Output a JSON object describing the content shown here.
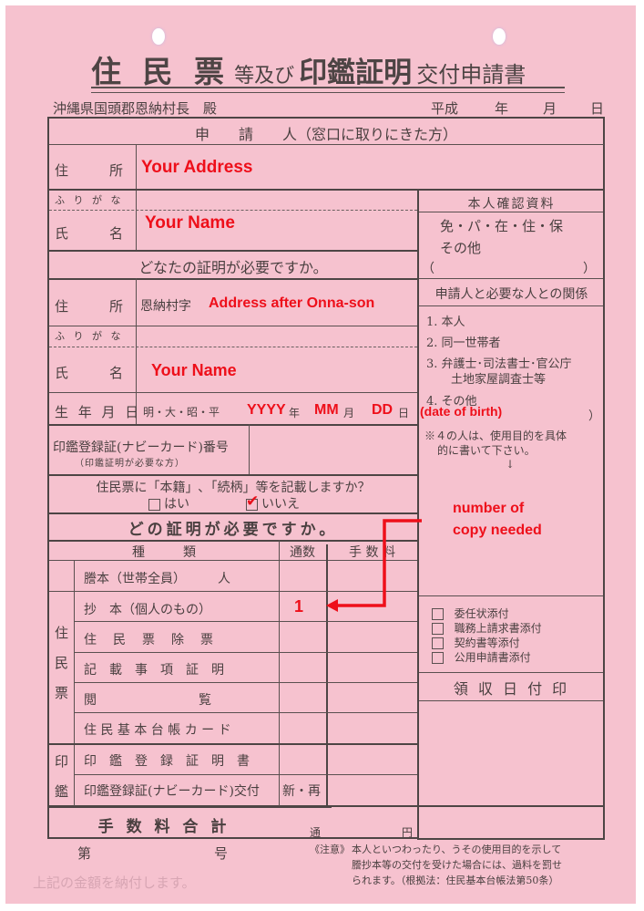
{
  "document": {
    "title_parts": [
      "住 民 票",
      "等及び",
      "印鑑証明",
      "交付申請書"
    ],
    "addressee": "沖縄県国頭郡恩納村長　殿",
    "date_label": {
      "era": "平成",
      "year": "年",
      "month": "月",
      "day": "日"
    }
  },
  "applicant": {
    "header": "申　　請　　人（窓口に取りにきた方）",
    "address_label": "住　　　所",
    "address_value": "Your Address",
    "furigana_label": "ふ り が な",
    "name_label": "氏　　　名",
    "name_value": "Your Name"
  },
  "id_docs": {
    "header": "本人確認資料",
    "options": "免・パ・在・住・保",
    "other": "その他",
    "paren_open": "（",
    "paren_close": "）"
  },
  "target_person": {
    "header": "どなたの証明が必要ですか。",
    "address_label": "住　　　所",
    "address_prefix": "恩納村字",
    "address_value": "Address after Onna-son",
    "furigana_label": "ふ り が な",
    "name_label": "氏　　　名",
    "name_value": "Your Name",
    "dob_label": "生 年 月 日",
    "era_options": "明・大・昭・平",
    "dob_year": "YYYY",
    "dob_year_unit": "年",
    "dob_month": "MM",
    "dob_month_unit": "月",
    "dob_day": "DD",
    "dob_day_unit": "日",
    "dob_annotation": "(date of birth)"
  },
  "relationship": {
    "header": "申請人と必要な人との関係",
    "items": [
      {
        "num": "1.",
        "text": "本人"
      },
      {
        "num": "2.",
        "text": "同一世帯者"
      },
      {
        "num": "3.",
        "text": "弁護士･司法書士･官公庁",
        "text2": "土地家屋調査士等"
      },
      {
        "num": "4.",
        "text": "その他"
      }
    ],
    "paren_close": "）",
    "note_line1": "※４の人は、使用目的を具体",
    "note_line2": "的に書いて下さい。",
    "arrow": "↓"
  },
  "seal_card": {
    "label": "印鑑登録証(ナビーカード)番号",
    "sub_label": "（印鑑証明が必要な方）",
    "value": ""
  },
  "honseki_question": {
    "text": "住民票に「本籍」､「続柄」等を記載しますか？",
    "yes_label": "はい",
    "no_label": "いいえ",
    "yes_checked": false,
    "no_checked": true,
    "check_mark": "✔"
  },
  "which_cert": {
    "header": "どの証明が必要ですか。",
    "col_type": "種　　　類",
    "col_copies": "通数",
    "col_fee": "手 数 料",
    "group_juminhyo": [
      "住",
      "民",
      "票"
    ],
    "group_inkan": [
      "印",
      "鑑"
    ],
    "rows": [
      {
        "label": "謄本（世帯全員）　　　人",
        "copies": ""
      },
      {
        "label": "抄　本（個人のもの）",
        "copies": "1"
      },
      {
        "label": "住　民　票　除　票",
        "copies": ""
      },
      {
        "label": "記　載　事　項　証　明",
        "copies": ""
      },
      {
        "label": "閲　　　　　　　　覧",
        "copies": ""
      },
      {
        "label": "住 民 基 本 台 帳 カ ー ド",
        "copies": ""
      },
      {
        "label": "印　鑑　登　録　証　明　書",
        "copies": ""
      },
      {
        "label": "印鑑登録証(ナビーカード)交付",
        "copies": "新・再"
      }
    ],
    "total_label": "手 数 料 合 計",
    "total_copies_unit": "通",
    "total_fee_unit": "円"
  },
  "attachments": [
    {
      "label": "委任状添付",
      "checked": false
    },
    {
      "label": "職務上請求書添付",
      "checked": false
    },
    {
      "label": "契約書等添付",
      "checked": false
    },
    {
      "label": "公用申請書添付",
      "checked": false
    }
  ],
  "receipt_stamp": "領 収 日 付 印",
  "footer": {
    "number_prefix": "第",
    "number_suffix": "号",
    "caution_label": "《注意》",
    "caution_line1": "本人といつわったり、うその使用目的を示して",
    "caution_line2": "謄抄本等の交付を受けた場合には、過料を罰せ",
    "caution_line3": "られます。（根拠法：住民基本台帳法第50条）",
    "faded_text": "上記の金額を納付します。"
  },
  "annotation": {
    "copies_note_line1": "number of",
    "copies_note_line2": "copy needed",
    "color": "#ee0f1a"
  }
}
